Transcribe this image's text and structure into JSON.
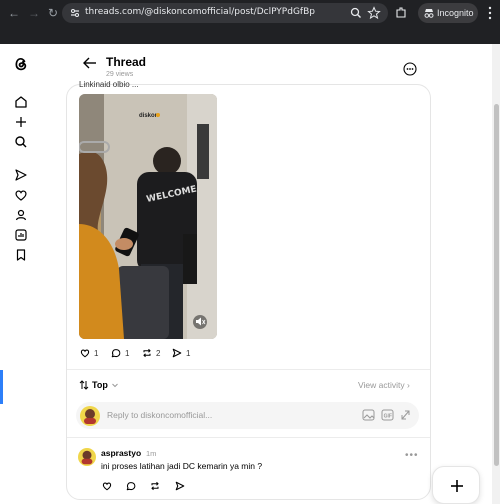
{
  "browser": {
    "url": "threads.com/@diskoncomofficial/post/DclPYPdGfBp",
    "incognito_label": "Incognito"
  },
  "header": {
    "title": "Thread",
    "views": "29 views"
  },
  "post": {
    "cut_text": "Linkinaid olbio ...",
    "video_watermark": "diskon",
    "likes": "1",
    "replies": "1",
    "reposts": "2",
    "shares": "1"
  },
  "sort": {
    "label": "Top",
    "view_activity": "View activity"
  },
  "reply": {
    "placeholder": "Reply to diskoncomofficial..."
  },
  "comment": {
    "username": "asprastyo",
    "time": "1m",
    "text": "ini proses latihan jadi DC kemarin ya min ?"
  },
  "colors": {
    "chrome_bg": "#202124",
    "card_border": "#e5e5e5",
    "muted_text": "#999999",
    "accent_edge": "#2d7ff9"
  },
  "icons": {
    "rail": [
      "threads-logo-icon",
      "home-icon",
      "plus-icon",
      "search-icon",
      "send-icon",
      "heart-icon",
      "profile-icon",
      "insights-icon",
      "bookmark-icon"
    ]
  }
}
